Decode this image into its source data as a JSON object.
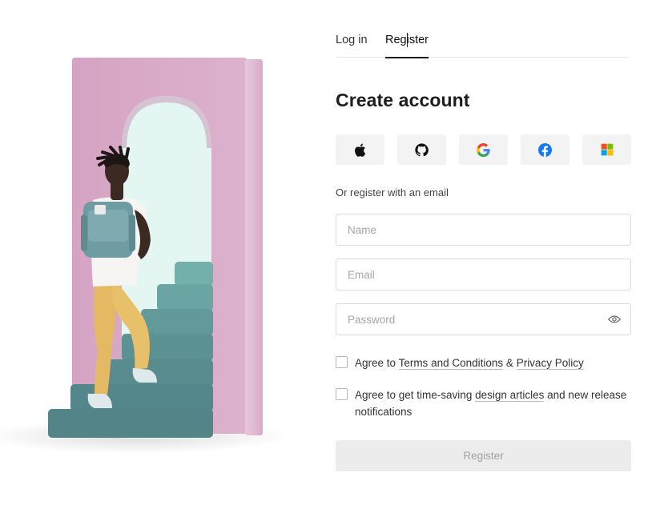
{
  "tabs": {
    "login": "Log in",
    "register": "Register",
    "active": "register"
  },
  "title": "Create account",
  "social": [
    {
      "icon": "apple-icon"
    },
    {
      "icon": "github-icon"
    },
    {
      "icon": "google-icon"
    },
    {
      "icon": "facebook-icon"
    },
    {
      "icon": "microsoft-icon"
    }
  ],
  "or_text": "Or register with an email",
  "form": {
    "name_placeholder": "Name",
    "name_value": "",
    "email_placeholder": "Email",
    "email_value": "",
    "password_placeholder": "Password",
    "password_value": ""
  },
  "agree1": {
    "prefix": "Agree to",
    "terms": "Terms and Conditions",
    "amp": "&",
    "privacy": "Privacy Policy",
    "checked": false
  },
  "agree2": {
    "prefix": "Agree to get time-saving",
    "link": "design articles",
    "suffix": "and new release notifications",
    "checked": false
  },
  "submit_label": "Register",
  "colors": {
    "arch_pink": "#d8aac8",
    "arch_opening": "#e2f6f1",
    "stairs": "#5d9a9c",
    "submit_disabled_bg": "#ececec",
    "tab_underline": "#1a1a1a"
  }
}
